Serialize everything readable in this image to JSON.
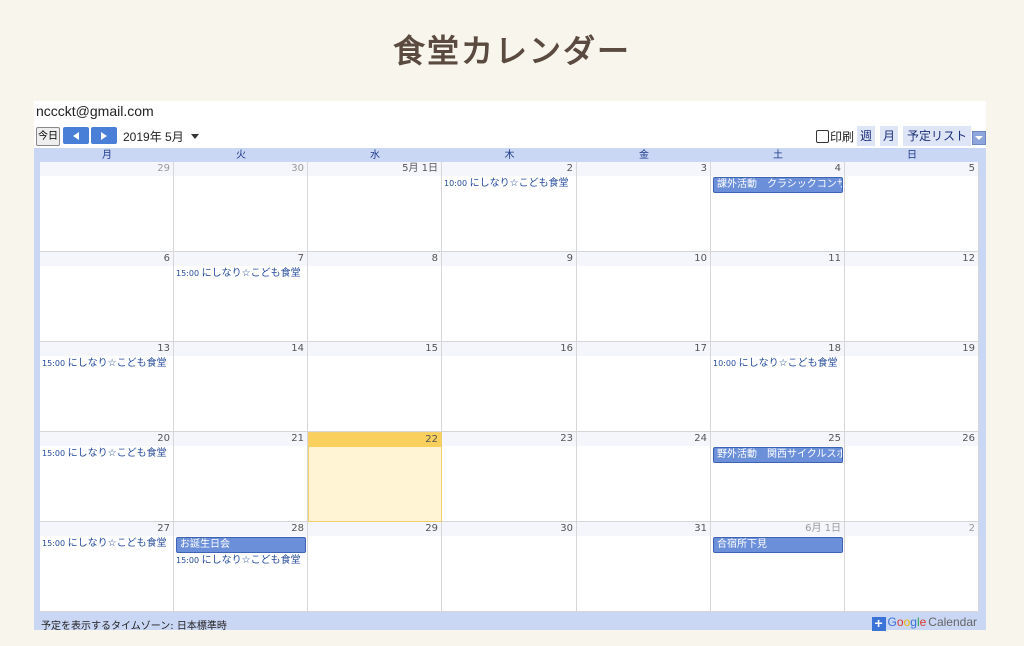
{
  "page": {
    "title": "食堂カレンダー"
  },
  "calendar": {
    "account": "nccckt@gmail.com",
    "toolbar": {
      "today": "今日",
      "month_label": "2019年 5月",
      "print": "印刷",
      "views": [
        "週",
        "月",
        "予定リスト"
      ]
    },
    "weekdays": [
      "月",
      "火",
      "水",
      "木",
      "金",
      "土",
      "日"
    ],
    "weeks": [
      [
        {
          "label": "29",
          "other": true,
          "events": []
        },
        {
          "label": "30",
          "other": true,
          "events": []
        },
        {
          "label": "5月 1日",
          "events": []
        },
        {
          "label": "2",
          "events": [
            {
              "time": "10:00",
              "title": "にしなり☆こども食堂"
            }
          ]
        },
        {
          "label": "3",
          "events": []
        },
        {
          "label": "4",
          "events": [
            {
              "bar": true,
              "title": "課外活動　クラシックコンサ"
            }
          ]
        },
        {
          "label": "5",
          "events": []
        }
      ],
      [
        {
          "label": "6",
          "events": []
        },
        {
          "label": "7",
          "events": [
            {
              "time": "15:00",
              "title": "にしなり☆こども食堂"
            }
          ]
        },
        {
          "label": "8",
          "events": []
        },
        {
          "label": "9",
          "events": []
        },
        {
          "label": "10",
          "events": []
        },
        {
          "label": "11",
          "events": []
        },
        {
          "label": "12",
          "events": []
        }
      ],
      [
        {
          "label": "13",
          "events": [
            {
              "time": "15:00",
              "title": "にしなり☆こども食堂"
            }
          ]
        },
        {
          "label": "14",
          "events": []
        },
        {
          "label": "15",
          "events": []
        },
        {
          "label": "16",
          "events": []
        },
        {
          "label": "17",
          "events": []
        },
        {
          "label": "18",
          "events": [
            {
              "time": "10:00",
              "title": "にしなり☆こども食堂"
            }
          ]
        },
        {
          "label": "19",
          "events": []
        }
      ],
      [
        {
          "label": "20",
          "events": [
            {
              "time": "15:00",
              "title": "にしなり☆こども食堂"
            }
          ]
        },
        {
          "label": "21",
          "events": []
        },
        {
          "label": "22",
          "today": true,
          "events": []
        },
        {
          "label": "23",
          "events": []
        },
        {
          "label": "24",
          "events": []
        },
        {
          "label": "25",
          "events": [
            {
              "bar": true,
              "title": "野外活動　関西サイクルスポ"
            }
          ]
        },
        {
          "label": "26",
          "events": []
        }
      ],
      [
        {
          "label": "27",
          "events": [
            {
              "time": "15:00",
              "title": "にしなり☆こども食堂"
            }
          ]
        },
        {
          "label": "28",
          "events": [
            {
              "bar": true,
              "title": "お誕生日会"
            },
            {
              "time": "15:00",
              "title": "にしなり☆こども食堂"
            }
          ]
        },
        {
          "label": "29",
          "events": []
        },
        {
          "label": "30",
          "events": []
        },
        {
          "label": "31",
          "events": []
        },
        {
          "label": "6月 1日",
          "other": true,
          "events": [
            {
              "bar": true,
              "title": "合宿所下見"
            }
          ]
        },
        {
          "label": "2",
          "other": true,
          "events": []
        }
      ]
    ],
    "footer": {
      "timezone": "予定を表示するタイムゾーン: 日本標準時",
      "brand": "Google",
      "product": "Calendar"
    }
  }
}
